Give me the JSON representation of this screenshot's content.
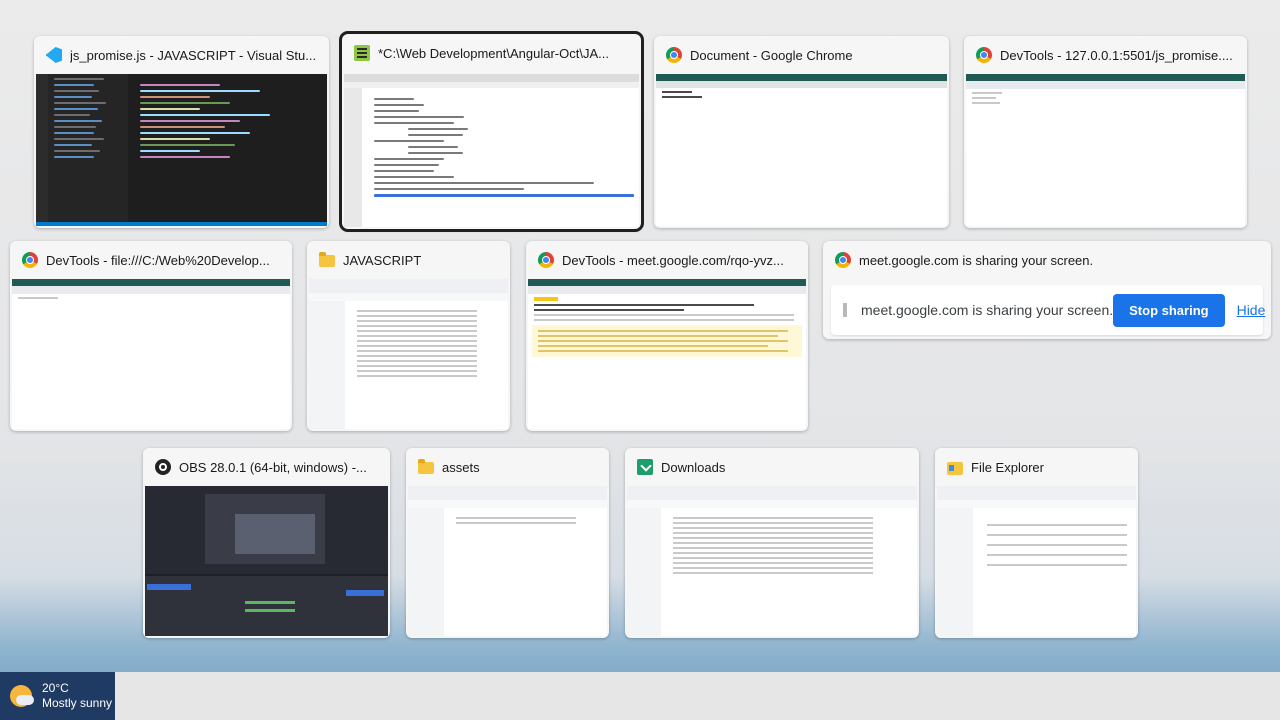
{
  "windows": [
    {
      "title": "js_promise.js - JAVASCRIPT - Visual Stu...",
      "icon": "vscode-icon"
    },
    {
      "title": "*C:\\Web Development\\Angular-Oct\\JA...",
      "icon": "notepad-plus-icon"
    },
    {
      "title": "Document - Google Chrome",
      "icon": "chrome-icon"
    },
    {
      "title": "DevTools - 127.0.0.1:5501/js_promise....",
      "icon": "chrome-icon"
    },
    {
      "title": "DevTools - file:///C:/Web%20Develop...",
      "icon": "chrome-icon"
    },
    {
      "title": "JAVASCRIPT",
      "icon": "folder-icon"
    },
    {
      "title": "DevTools - meet.google.com/rqo-yvz...",
      "icon": "chrome-icon"
    },
    {
      "title": "meet.google.com is sharing your screen.",
      "icon": "chrome-icon"
    },
    {
      "title": "OBS 28.0.1 (64-bit, windows) -...",
      "icon": "obs-icon"
    },
    {
      "title": "assets",
      "icon": "folder-icon"
    },
    {
      "title": "Downloads",
      "icon": "downloads-icon"
    },
    {
      "title": "File Explorer",
      "icon": "file-explorer-icon"
    }
  ],
  "sharing": {
    "message": "meet.google.com is sharing your screen.",
    "stop_label": "Stop sharing",
    "hide_label": "Hide"
  },
  "taskbar": {
    "weather_temp": "20°C",
    "weather_condition": "Mostly sunny"
  },
  "colors": {
    "chrome_blue": "#1a73e8",
    "vscode_bg": "#1e1e1e",
    "selected_outline": "#1f1f1f",
    "weather_bg": "#1f3a63"
  }
}
